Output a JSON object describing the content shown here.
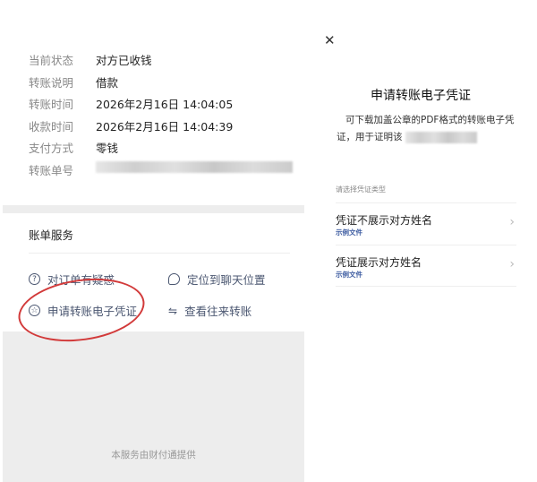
{
  "details": [
    {
      "label": "当前状态",
      "value": "对方已收钱"
    },
    {
      "label": "转账说明",
      "value": "借款"
    },
    {
      "label": "转账时间",
      "value": "2026年2月16日 14:04:05"
    },
    {
      "label": "收款时间",
      "value": "2026年2月16日 14:04:39"
    },
    {
      "label": "支付方式",
      "value": "零钱"
    },
    {
      "label": "转账单号",
      "value": ""
    }
  ],
  "services": {
    "title": "账单服务",
    "items": [
      {
        "label": "对订单有疑惑",
        "icon": "question-icon"
      },
      {
        "label": "定位到聊天位置",
        "icon": "chat-bubble-icon"
      },
      {
        "label": "申请转账电子凭证",
        "icon": "badge-icon"
      },
      {
        "label": "查看往来转账",
        "icon": "swap-icon"
      }
    ]
  },
  "footer": "本服务由财付通提供",
  "dialog": {
    "title": "申请转账电子凭证",
    "description": "可下载加盖公章的PDF格式的转账电子凭证，用于证明该",
    "prompt": "请选择凭证类型",
    "options": [
      {
        "title": "凭证不展示对方姓名",
        "link": "示例文件"
      },
      {
        "title": "凭证展示对方姓名",
        "link": "示例文件"
      }
    ]
  },
  "colors": {
    "annotation": "#d23a3a",
    "link": "#3b5aa0"
  }
}
